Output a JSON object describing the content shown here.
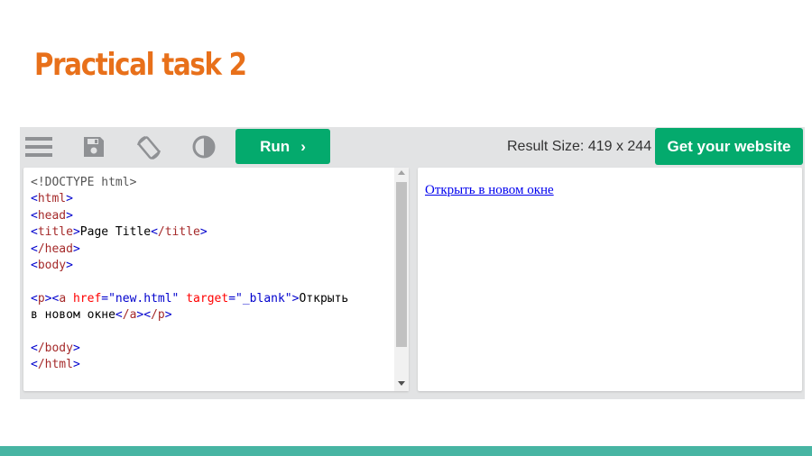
{
  "slide": {
    "title": "Practical task 2"
  },
  "toolbar": {
    "menu_icon": "hamburger-menu-icon",
    "save_icon": "floppy-disk-icon",
    "rotate_icon": "rotate-screen-icon",
    "contrast_icon": "half-contrast-icon",
    "run_label": "Run",
    "run_chevron": "›",
    "result_size": "Result Size: 419 x 244",
    "get_website_label": "Get your website"
  },
  "code": {
    "lines": [
      "<!DOCTYPE html>",
      "<html>",
      "<head>",
      "<title>Page Title</title>",
      "</head>",
      "<body>",
      "",
      "<p><a href=\"new.html\" target=\"_blank\">Открыть",
      "в новом окне</a></p>",
      "",
      "</body>",
      "</html>"
    ],
    "segments": {
      "doctype": "<!DOCTYPE html>",
      "html_open": "html",
      "head_open": "head",
      "title_open": "title",
      "title_text": "Page Title",
      "title_close": "/title",
      "head_close": "/head",
      "body_open": "body",
      "p_open": "p",
      "a_open": "a",
      "href_attr": "href",
      "href_val": "\"new.html\"",
      "target_attr": "target",
      "target_val": "\"_blank\"",
      "link_text_1": "Открыть",
      "link_text_2": "в новом окне",
      "a_close": "/a",
      "p_close": "/p",
      "body_close": "/body",
      "html_close": "/html"
    }
  },
  "result": {
    "link_text": "Открыть в новом окне"
  },
  "colors": {
    "title": "#e8701a",
    "accent_green": "#04aa6d",
    "footer_teal": "#47b5a3",
    "tag": "#a52a2a",
    "attr": "#ff0000",
    "value": "#0000cd",
    "link": "#0000ee"
  }
}
